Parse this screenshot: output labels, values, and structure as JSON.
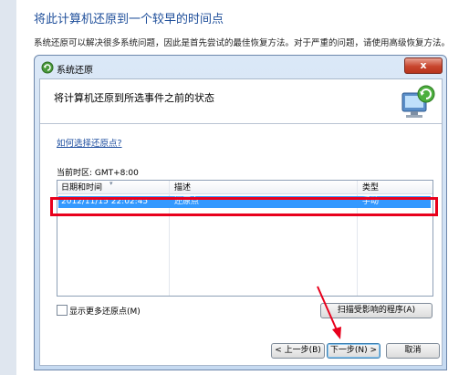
{
  "page": {
    "heading": "将此计算机还原到一个较早的时间点",
    "description": "系统还原可以解决很多系统问题，因此是首先尝试的最佳恢复方法。对于严重的问题，请使用高级恢复方法。"
  },
  "dialog": {
    "title": "系统还原",
    "close_glyph": "x",
    "subtitle": "将计算机还原到所选事件之前的状态",
    "help_link": "如何选择还原点?",
    "timezone": "当前时区: GMT+8:00",
    "table": {
      "columns": [
        "日期和时间",
        "描述",
        "类型"
      ],
      "rows": [
        {
          "date": "2012/11/15 22:02:45",
          "description": "还原点",
          "type": "手动"
        }
      ]
    },
    "show_more_label": "显示更多还原点(M)",
    "show_more_checked": false,
    "scan_button": "扫描受影响的程序(A)",
    "back_button": "< 上一步(B)",
    "next_button": "下一步(N) >",
    "cancel_button": "取消"
  },
  "colors": {
    "accent_link": "#1f4fa0",
    "selection": "#3399ff",
    "annotation_red": "#e8001c"
  }
}
